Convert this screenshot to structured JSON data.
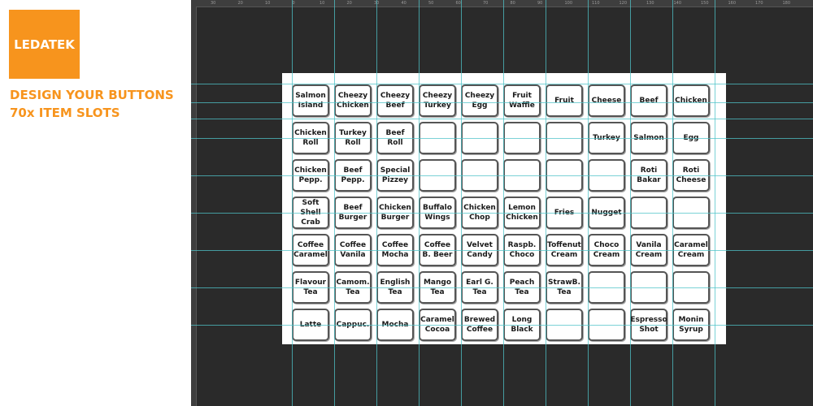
{
  "branding": {
    "logo_text": "LEDATEK",
    "headline_1": "DESIGN YOUR BUTTONS",
    "headline_2": "70x ITEM SLOTS",
    "accent_color": "#f7941d"
  },
  "ruler": {
    "labels": [
      "30",
      "20",
      "10",
      "0",
      "10",
      "20",
      "30",
      "40",
      "50",
      "60",
      "70",
      "80",
      "90",
      "100",
      "110",
      "120",
      "130",
      "140",
      "150",
      "160",
      "170",
      "180"
    ]
  },
  "guide_color": "#4fc3c8",
  "slots": [
    [
      "Salmon\nIsland",
      "Cheezy\nChicken",
      "Cheezy\nBeef",
      "Cheezy\nTurkey",
      "Cheezy\nEgg",
      "Fruit\nWaffle",
      "Fruit",
      "Cheese",
      "Beef",
      "Chicken"
    ],
    [
      "Chicken\nRoll",
      "Turkey\nRoll",
      "Beef\nRoll",
      "",
      "",
      "",
      "",
      "Turkey",
      "Salmon",
      "Egg"
    ],
    [
      "Chicken\nPepp.",
      "Beef\nPepp.",
      "Special\nPizzey",
      "",
      "",
      "",
      "",
      "",
      "Roti\nBakar",
      "Roti\nCheese"
    ],
    [
      "Soft Shell\nCrab",
      "Beef\nBurger",
      "Chicken\nBurger",
      "Buffalo\nWings",
      "Chicken\nChop",
      "Lemon\nChicken",
      "Fries",
      "Nugget",
      "",
      ""
    ],
    [
      "Coffee\nCaramel",
      "Coffee\nVanila",
      "Coffee\nMocha",
      "Coffee\nB. Beer",
      "Velvet\nCandy",
      "Raspb.\nChoco",
      "Toffenut\nCream",
      "Choco\nCream",
      "Vanila\nCream",
      "Caramel\nCream"
    ],
    [
      "Flavour\nTea",
      "Camom.\nTea",
      "English\nTea",
      "Mango\nTea",
      "Earl G.\nTea",
      "Peach\nTea",
      "StrawB.\nTea",
      "",
      "",
      ""
    ],
    [
      "Latte",
      "Cappuc.",
      "Mocha",
      "Caramel\nCocoa",
      "Brewed\nCoffee",
      "Long\nBlack",
      "",
      "",
      "Espresso\nShot",
      "Monin\nSyrup"
    ]
  ]
}
